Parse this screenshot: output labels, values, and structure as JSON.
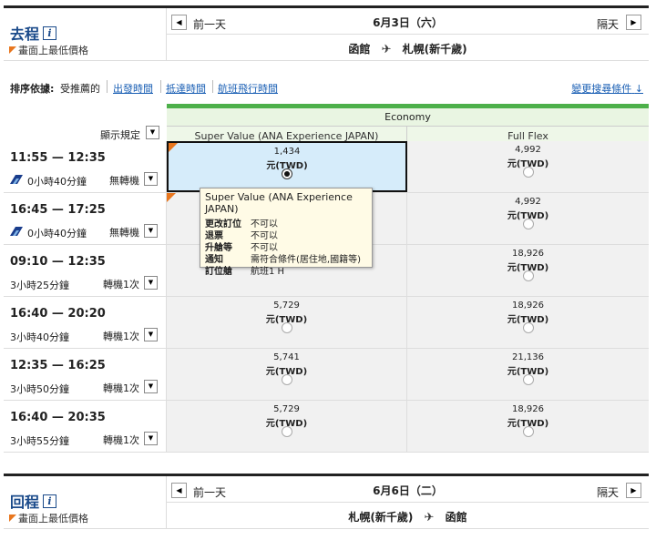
{
  "outbound": {
    "title": "去程",
    "info_icon": "info-icon",
    "lowest_label": "畫面上最低價格",
    "prev_label": "前一天",
    "next_label": "隔天",
    "date": "6月3日（六）",
    "from": "函館",
    "to": "札幌(新千歲)"
  },
  "sort": {
    "label": "排序依據:",
    "options": [
      "受推薦的",
      "出發時間",
      "抵達時間",
      "航班飛行時間"
    ],
    "advanced": "變更搜尋條件"
  },
  "cabin": "Economy",
  "fare_types": [
    "Super Value (ANA Experience JAPAN)",
    "Full Flex"
  ],
  "display_rule": "顯示規定",
  "currency": "元(TWD)",
  "flights": [
    {
      "time": "11:55 — 12:35",
      "duration": "0小時40分鐘",
      "stops": "無轉機",
      "airline": true,
      "fare1": "1,434",
      "fare2": "4,992",
      "selected": true
    },
    {
      "time": "16:45 — 17:25",
      "duration": "0小時40分鐘",
      "stops": "無轉機",
      "airline": true,
      "fare1": "",
      "fare2": "4,992",
      "selected": false
    },
    {
      "time": "09:10 — 12:35",
      "duration": "3小時25分鐘",
      "stops": "轉機1次",
      "airline": false,
      "fare1": "",
      "fare2": "18,926",
      "selected": false
    },
    {
      "time": "16:40 — 20:20",
      "duration": "3小時40分鐘",
      "stops": "轉機1次",
      "airline": false,
      "fare1": "5,729",
      "fare2": "18,926",
      "selected": false
    },
    {
      "time": "12:35 — 16:25",
      "duration": "3小時50分鐘",
      "stops": "轉機1次",
      "airline": false,
      "fare1": "5,741",
      "fare2": "21,136",
      "selected": false
    },
    {
      "time": "16:40 — 20:35",
      "duration": "3小時55分鐘",
      "stops": "轉機1次",
      "airline": false,
      "fare1": "5,729",
      "fare2": "18,926",
      "selected": false
    }
  ],
  "tooltip": {
    "title": "Super Value (ANA Experience JAPAN)",
    "rows": [
      {
        "key": "更改訂位",
        "value": "不可以"
      },
      {
        "key": "退票",
        "value": "不可以"
      },
      {
        "key": "升艙等",
        "value": "不可以"
      },
      {
        "key": "通知",
        "value": "需符合條件(居住地,國籍等)"
      },
      {
        "key": "訂位艙",
        "value": "航班1 H"
      }
    ]
  },
  "return": {
    "title": "回程",
    "lowest_label": "畫面上最低價格",
    "prev_label": "前一天",
    "next_label": "隔天",
    "date": "6月6日（二）",
    "from": "札幌(新千歲)",
    "to": "函館"
  },
  "colors": {
    "accent": "#1a4a8a",
    "link": "#1a5fb4",
    "green": "#4db04a",
    "flag": "#e8761e",
    "selected": "#d6ecfa"
  }
}
